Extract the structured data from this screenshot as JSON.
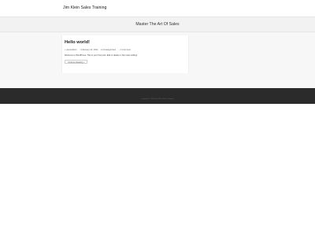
{
  "header": {
    "site_title": "Jim Klein Sales Training"
  },
  "hero": {
    "title": "Master The Art Of Sales"
  },
  "post": {
    "title": "Hello world!",
    "meta": {
      "author": "JamesKlein",
      "date": "February 22, 2022",
      "category": "Uncategorized",
      "comments": "1 Comment"
    },
    "excerpt": "Welcome to WordPress. This is your first post. Edit or delete it, then start writing!",
    "read_more_label": "Continue Reading »"
  },
  "footer": {
    "text": "Copyright © 2022 Jim Klein Sales Training"
  }
}
